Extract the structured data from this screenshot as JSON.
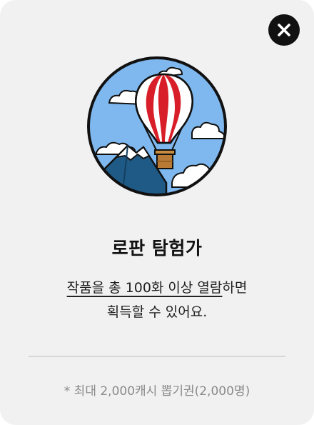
{
  "achievement": {
    "badge_icon": "hot-air-balloon-badge-icon",
    "title": "로판 탐험가",
    "description_line1_underlined": "작품을 총 100화 이상 열람",
    "description_line1_rest": "하면",
    "description_line2": "획득할 수 있어요.",
    "reward_note": "* 최대 2,000캐시 뽑기권(2,000명)"
  },
  "close_button": {
    "icon": "close-icon"
  },
  "colors": {
    "card_background": "#f1f1f1",
    "close_button": "#111111",
    "sky": "#7fb8ef",
    "balloon_red": "#d81e28",
    "mountain": "#1f5a86",
    "divider": "#d6d6d6",
    "note_text": "#8a8a8a"
  }
}
